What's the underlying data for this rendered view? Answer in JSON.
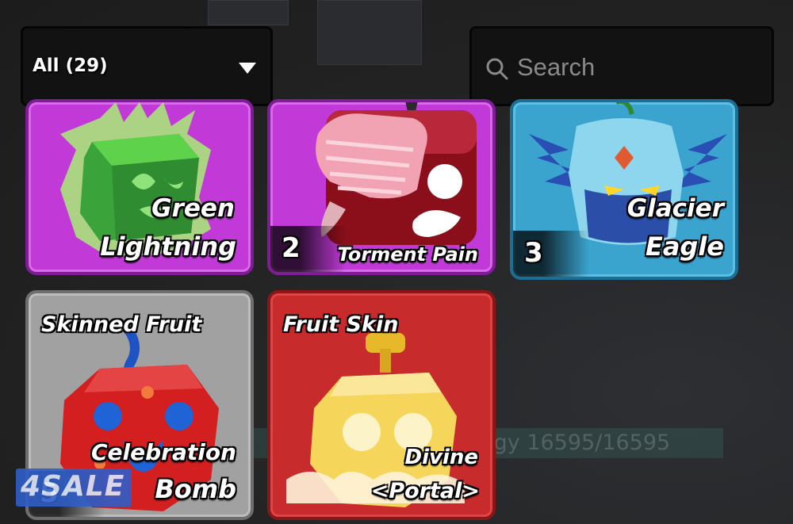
{
  "filter": {
    "label": "All (29)"
  },
  "search": {
    "placeholder": "Search"
  },
  "cards": {
    "green_lightning": {
      "name_line1": "Green",
      "name_line2": "Lightning"
    },
    "torment_pain": {
      "name": "Torment Pain",
      "count": "2"
    },
    "glacier_eagle": {
      "name_line1": "Glacier",
      "name_line2": "Eagle",
      "count": "3"
    },
    "celebration_bomb": {
      "tag": "Skinned Fruit",
      "name_line1": "Celebration",
      "name_line2": "Bomb",
      "count": "5"
    },
    "divine_portal": {
      "tag": "Fruit Skin",
      "name_line1": "Divine",
      "name_line2": "<Portal>"
    }
  },
  "background": {
    "hud_text": "rgy 16595/16595"
  },
  "watermark": {
    "text": "4SALE"
  },
  "colors": {
    "purple_rarity": "#c13ad8",
    "blue_rarity": "#3aa3ce",
    "gray_rarity": "#a1a1a1",
    "red_rarity": "#c72b2b"
  }
}
